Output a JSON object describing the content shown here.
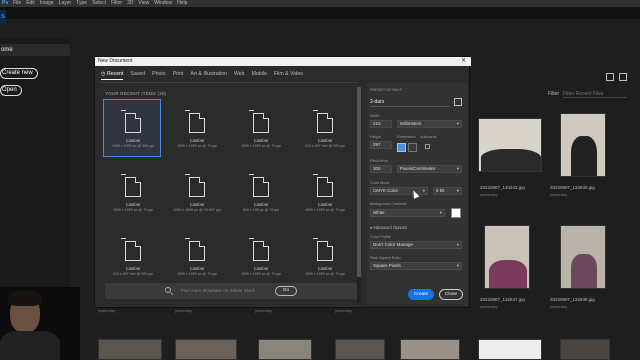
{
  "menubar": {
    "logo": "Ps",
    "items": [
      "File",
      "Edit",
      "Image",
      "Layer",
      "Type",
      "Select",
      "Filter",
      "3D",
      "View",
      "Window",
      "Help"
    ]
  },
  "home": {
    "home_label": "ome",
    "create_new": "Create new",
    "open": "Open"
  },
  "library": {
    "filter_label": "Filter",
    "filter_placeholder": "Filter Recent Files",
    "files": [
      {
        "name": "20220907_134243.jpg",
        "date": "yesterday"
      },
      {
        "name": "20220907_133830.jpg",
        "date": "yesterday"
      },
      {
        "name": "20220907_132647.jpg",
        "date": "yesterday"
      },
      {
        "name": "20220907_132638.jpg",
        "date": "yesterday"
      }
    ],
    "row_dates": [
      "yesterday",
      "yesterday",
      "yesterday",
      "yesterday"
    ]
  },
  "dialog": {
    "title": "New Document",
    "tabs": [
      "Recent",
      "Saved",
      "Photo",
      "Print",
      "Art & Illustration",
      "Web",
      "Mobile",
      "Film & Video"
    ],
    "recent_header": "YOUR RECENT ITEMS (20)",
    "items": [
      {
        "name": "Custom",
        "dims": "1000 x 1000 px @ 300 ppi"
      },
      {
        "name": "Custom",
        "dims": "1000 x 1000 px @ 72 ppi"
      },
      {
        "name": "Custom",
        "dims": "1000 x 1000 px @ 72 ppi"
      },
      {
        "name": "Custom",
        "dims": "210 x 297 mm @ 300 ppi"
      },
      {
        "name": "Custom",
        "dims": "2000 x 1000 px @ 72 ppi"
      },
      {
        "name": "Custom",
        "dims": "1000 x 1000 px @ 76.997 ppi"
      },
      {
        "name": "Custom",
        "dims": "500 x 135 px @ 72 ppi"
      },
      {
        "name": "Custom",
        "dims": "4500 x 1000 px @ 72 ppi"
      },
      {
        "name": "Custom",
        "dims": "210 x 297 mm @ 300 ppi"
      },
      {
        "name": "Custom",
        "dims": "1000 x 1000 px @ 72 ppi"
      },
      {
        "name": "Custom",
        "dims": "1000 x 1000 px @ 72 ppi"
      },
      {
        "name": "Custom",
        "dims": "1000 x 1000 px @ 72 ppi"
      }
    ],
    "search_placeholder": "Find more templates on Adobe Stock",
    "go_label": "Go",
    "preset": {
      "header": "PRESET DETAILS",
      "doc_name": "2-dars",
      "width_label": "Width",
      "width": "210",
      "width_unit": "Millimeters",
      "height_label": "Height",
      "height": "297",
      "orientation_label": "Orientation",
      "artboards_label": "Artboards",
      "resolution_label": "Resolution",
      "resolution": "300",
      "resolution_unit": "Pixels/Centimeter",
      "color_mode_label": "Color Mode",
      "color_mode": "CMYK Color",
      "bit_depth": "8 bit",
      "background_label": "Background Contents",
      "background": "White",
      "advanced": "Advanced Options",
      "color_profile_label": "Color Profile",
      "color_profile": "Don't Color Manage",
      "pixel_aspect_label": "Pixel Aspect Ratio",
      "pixel_aspect": "Square Pixels"
    },
    "create_label": "Create",
    "close_label": "Close"
  }
}
